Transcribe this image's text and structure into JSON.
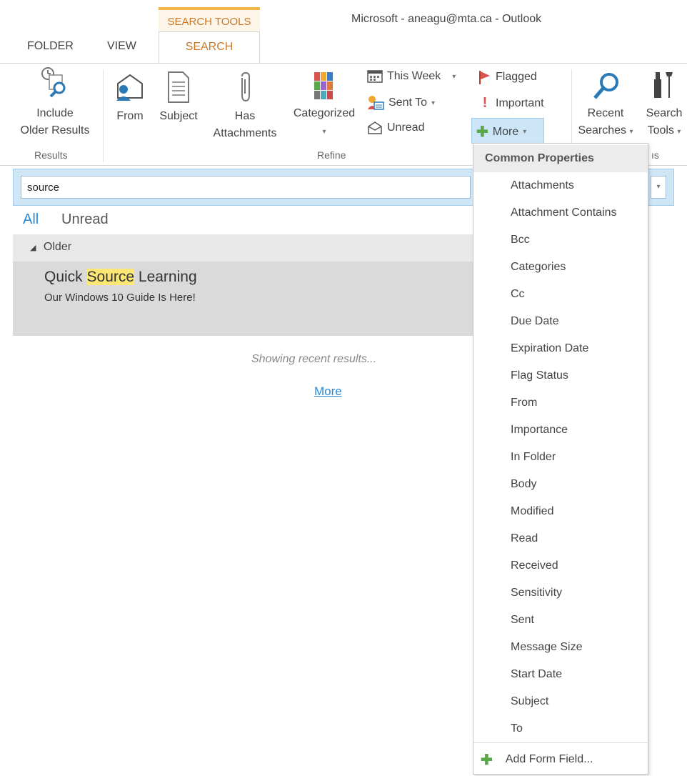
{
  "window": {
    "contextual_tab": "SEARCH TOOLS",
    "title": "Microsoft - aneagu@mta.ca - Outlook"
  },
  "tabs": [
    "FOLDER",
    "VIEW",
    "SEARCH"
  ],
  "ribbon": {
    "results": {
      "include_older_line1": "Include",
      "include_older_line2": "Older Results",
      "group_label": "Results"
    },
    "refine": {
      "from": "From",
      "subject": "Subject",
      "has_attachments_line1": "Has",
      "has_attachments_line2": "Attachments",
      "categorized": "Categorized",
      "this_week": "This Week",
      "sent_to": "Sent To",
      "unread": "Unread",
      "flagged": "Flagged",
      "important": "Important",
      "more": "More",
      "group_label": "Refine"
    },
    "options": {
      "recent_searches_line1": "Recent",
      "recent_searches_line2": "Searches",
      "search_tools_line1": "Search",
      "search_tools_line2": "Tools",
      "group_label_partial": "ıs"
    }
  },
  "search": {
    "value": "source"
  },
  "filters": {
    "all": "All",
    "unread": "Unread"
  },
  "mail_list": {
    "group": "Older",
    "item": {
      "sender_pre": "Quick ",
      "sender_highlight": "Source",
      "sender_post": " Learning",
      "subject": "Our Windows 10 Guide Is Here!"
    },
    "status": "Showing recent results...",
    "more_link": "More"
  },
  "dropdown": {
    "header": "Common Properties",
    "items": [
      "Attachments",
      "Attachment Contains",
      "Bcc",
      "Categories",
      "Cc",
      "Due Date",
      "Expiration Date",
      "Flag Status",
      "From",
      "Importance",
      "In Folder",
      "Body",
      "Modified",
      "Read",
      "Received",
      "Sensitivity",
      "Sent",
      "Message Size",
      "Start Date",
      "Subject",
      "To"
    ],
    "add_form_field": "Add Form Field..."
  },
  "colors": {
    "accent_orange": "#c9782a",
    "link_blue": "#2a8ad4",
    "highlight_yellow": "#fce674",
    "plus_green": "#5ba84a"
  }
}
